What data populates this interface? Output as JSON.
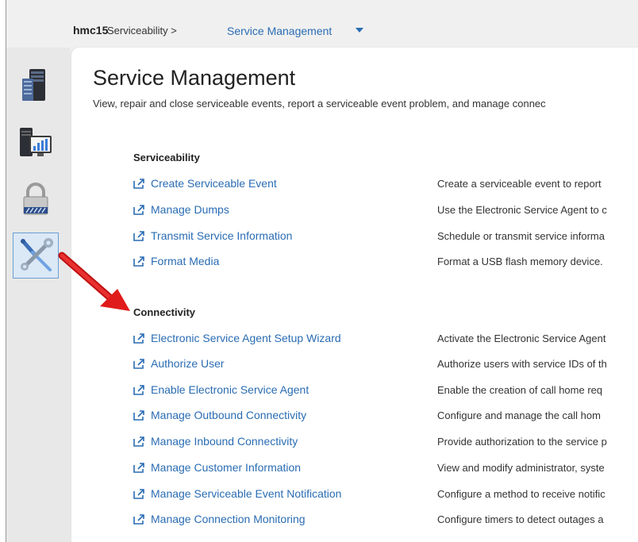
{
  "breadcrumb": {
    "host": "hmc15",
    "parent": "Serviceability >",
    "current": "Service Management"
  },
  "nav": {
    "items": [
      {
        "icon": "server-icon"
      },
      {
        "icon": "monitor-chart-icon"
      },
      {
        "icon": "padlock-icon"
      },
      {
        "icon": "wrench-screwdriver-icon",
        "selected": true
      }
    ]
  },
  "page": {
    "title": "Service Management",
    "description": "View, repair and close serviceable events, report a serviceable event problem, and manage connec"
  },
  "sections": [
    {
      "heading": "Serviceability",
      "tasks": [
        {
          "label": "Create Serviceable Event",
          "desc": "Create a serviceable event to report"
        },
        {
          "label": "Manage Dumps",
          "desc": "Use the Electronic Service Agent to c"
        },
        {
          "label": "Transmit Service Information",
          "desc": "Schedule or transmit service informa"
        },
        {
          "label": "Format Media",
          "desc": "Format a USB flash memory device."
        }
      ]
    },
    {
      "heading": "Connectivity",
      "tasks": [
        {
          "label": "Electronic Service Agent Setup Wizard",
          "desc": "Activate the Electronic Service Agent"
        },
        {
          "label": "Authorize User",
          "desc": "Authorize users with service IDs of th"
        },
        {
          "label": "Enable Electronic Service Agent",
          "desc": "Enable the creation of call home req"
        },
        {
          "label": "Manage Outbound Connectivity",
          "desc": "Configure and manage the call hom"
        },
        {
          "label": "Manage Inbound Connectivity",
          "desc": "Provide authorization to the service p"
        },
        {
          "label": "Manage Customer Information",
          "desc": "View and modify administrator, syste"
        },
        {
          "label": "Manage Serviceable Event Notification",
          "desc": "Configure a method to receive notific"
        },
        {
          "label": "Manage Connection Monitoring",
          "desc": "Configure timers to detect outages a"
        }
      ]
    }
  ],
  "colors": {
    "link": "#2a6cb3",
    "arrow": "#e01b1b"
  }
}
